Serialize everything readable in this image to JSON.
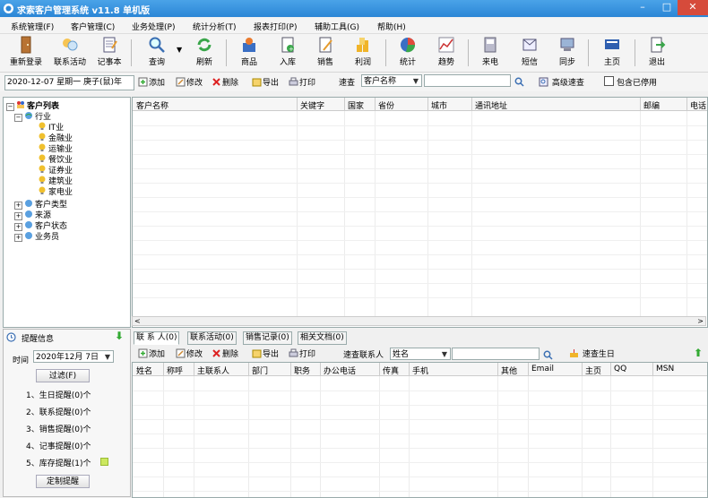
{
  "window": {
    "title": "求索客户管理系统 v11.8 单机版",
    "min": "–",
    "max": "□",
    "close": "✕"
  },
  "menu": [
    "系统管理(F)",
    "客户管理(C)",
    "业务处理(P)",
    "统计分析(T)",
    "报表打印(P)",
    "辅助工具(G)",
    "帮助(H)"
  ],
  "toolbar": {
    "buttons": [
      {
        "label": "重新登录",
        "icon": "door-icon"
      },
      {
        "label": "联系活动",
        "icon": "contact-activity-icon"
      },
      {
        "label": "记事本",
        "icon": "notebook-icon"
      },
      {
        "label": "查询",
        "icon": "magnifier-icon"
      },
      {
        "label": "刷新",
        "icon": "refresh-icon"
      },
      {
        "label": "商品",
        "icon": "goods-icon"
      },
      {
        "label": "入库",
        "icon": "stock-in-icon"
      },
      {
        "label": "销售",
        "icon": "sales-icon"
      },
      {
        "label": "利润",
        "icon": "profit-icon"
      },
      {
        "label": "统计",
        "icon": "pie-chart-icon"
      },
      {
        "label": "趋势",
        "icon": "trend-icon"
      },
      {
        "label": "来电",
        "icon": "phone-icon"
      },
      {
        "label": "短信",
        "icon": "sms-icon"
      },
      {
        "label": "同步",
        "icon": "sync-icon"
      },
      {
        "label": "主页",
        "icon": "home-icon"
      },
      {
        "label": "退出",
        "icon": "exit-icon"
      }
    ]
  },
  "actionbar": {
    "date": "2020-12-07 星期一 庚子(鼠)年",
    "add": "添加",
    "edit": "修改",
    "delete": "删除",
    "export": "导出",
    "print": "打印",
    "quick_search_label": "速查",
    "quick_search_field": "客户名称",
    "advanced": "高级速查",
    "include_disabled": "包含已停用"
  },
  "tree": {
    "root": "客户列表",
    "industry": "行业",
    "industries": [
      "IT业",
      "金融业",
      "运输业",
      "餐饮业",
      "证券业",
      "建筑业",
      "家电业"
    ],
    "others": [
      "客户类型",
      "来源",
      "客户状态",
      "业务员"
    ],
    "expanded": "−",
    "collapsed": "+"
  },
  "customer_table": {
    "columns": [
      "客户名称",
      "关键字",
      "国家",
      "省份",
      "城市",
      "通讯地址",
      "邮编",
      "电话"
    ]
  },
  "scroll": {
    "left": "<",
    "right": ">"
  },
  "reminders": {
    "title": "提醒信息",
    "time_label": "时间",
    "time_value": "2020年12月 7日",
    "filter": "过滤(F)",
    "items": [
      "1、生日提醒(0)个",
      "2、联系提醒(0)个",
      "3、销售提醒(0)个",
      "4、记事提醒(0)个",
      "5、库存提醒(1)个"
    ],
    "custom": "定制提醒",
    "arrow": "⬇"
  },
  "tabs": [
    "联 系 人(0)",
    "联系活动(0)",
    "销售记录(0)",
    "相关文档(0)"
  ],
  "contact_actions": {
    "add": "添加",
    "edit": "修改",
    "delete": "删除",
    "export": "导出",
    "print": "打印",
    "quick_label": "速查联系人",
    "quick_field": "姓名",
    "birthday": "速查生日",
    "arrow": "⬆"
  },
  "contact_table": {
    "columns": [
      "姓名",
      "称呼",
      "主联系人",
      "部门",
      "职务",
      "办公电话",
      "传真",
      "手机",
      "其他",
      "Email",
      "主页",
      "QQ",
      "MSN"
    ]
  }
}
